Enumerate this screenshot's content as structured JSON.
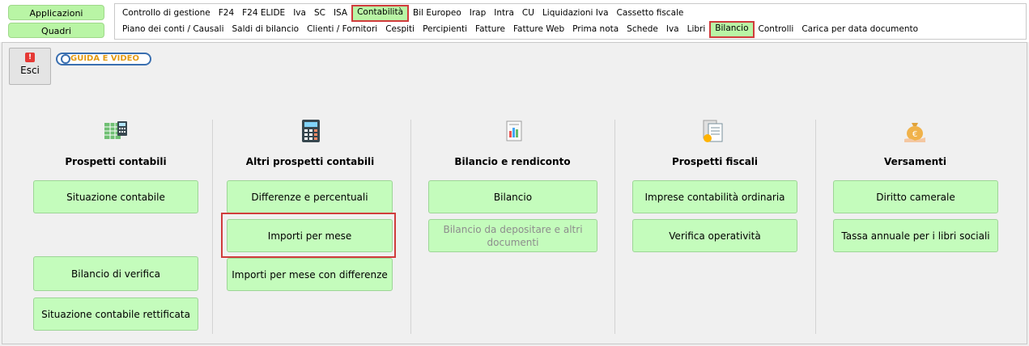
{
  "app_buttons": {
    "applicazioni": "Applicazioni",
    "quadri": "Quadri"
  },
  "menu_row1": [
    "Controllo di gestione",
    "F24",
    "F24 ELIDE",
    "Iva",
    "SC",
    "ISA",
    "Contabilità",
    "Bil Europeo",
    "Irap",
    "Intra",
    "CU",
    "Liquidazioni Iva",
    "Cassetto fiscale"
  ],
  "menu_row1_active": "Contabilità",
  "menu_row2": [
    "Piano dei conti / Causali",
    "Saldi di bilancio",
    "Clienti / Fornitori",
    "Cespiti",
    "Percipienti",
    "Fatture",
    "Fatture Web",
    "Prima nota",
    "Schede",
    "Iva",
    "Libri",
    "Bilancio",
    "Controlli",
    "Carica per data documento"
  ],
  "menu_row2_active": "Bilancio",
  "toolbar": {
    "esci_label": "Esci",
    "guida_label": "GUIDA E VIDEO"
  },
  "columns": [
    {
      "title": "Prospetti contabili",
      "icon": "spreadsheet-calculator-icon",
      "buttons": [
        "Situazione contabile",
        "Bilancio di verifica",
        "Situazione contabile rettificata"
      ]
    },
    {
      "title": "Altri prospetti contabili",
      "icon": "calculator-icon",
      "buttons": [
        "Differenze e percentuali",
        "Importi per mese",
        "Importi per mese con differenze"
      ]
    },
    {
      "title": "Bilancio e rendiconto",
      "icon": "report-document-icon",
      "buttons": [
        "Bilancio",
        "Bilancio da depositare e altri documenti"
      ]
    },
    {
      "title": "Prospetti fiscali",
      "icon": "tax-documents-icon",
      "buttons": [
        "Imprese contabilità ordinaria",
        "Verifica operatività"
      ]
    },
    {
      "title": "Versamenti",
      "icon": "money-bag-icon",
      "buttons": [
        "Diritto camerale",
        "Tassa annuale per i libri sociali"
      ]
    }
  ],
  "colors": {
    "button_green": "#c4fcbc",
    "highlight_red": "#d03c3c",
    "active_menu_green": "#b9f5a5"
  }
}
